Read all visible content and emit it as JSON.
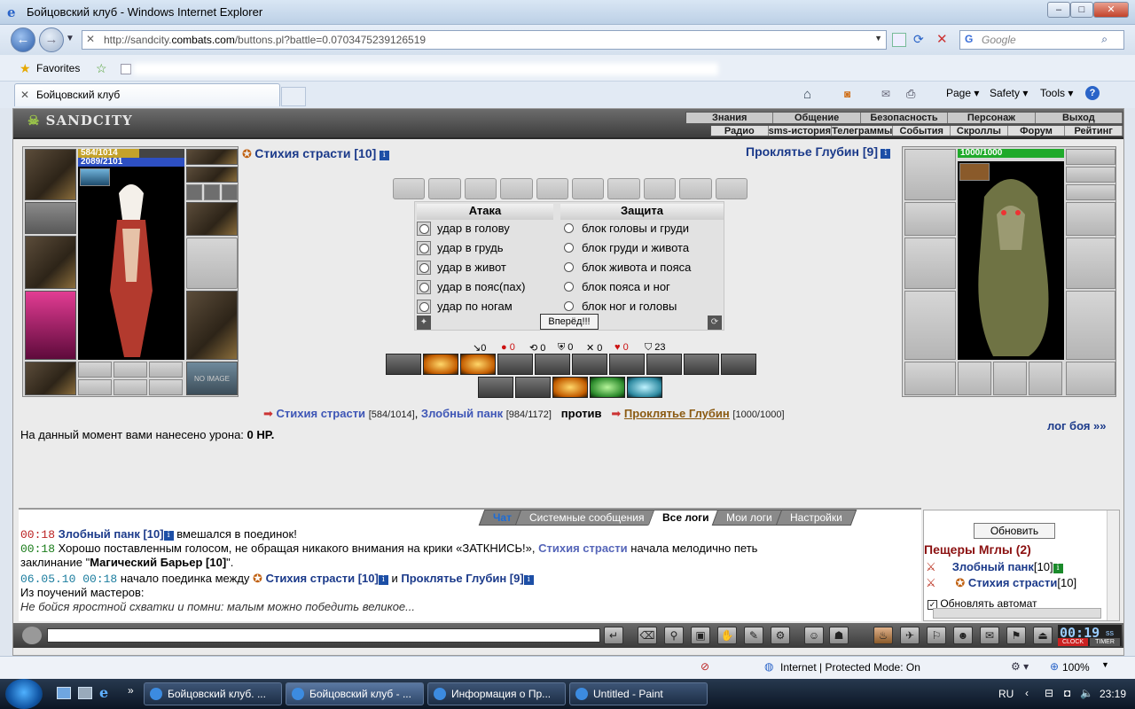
{
  "window": {
    "title": "Бойцовский клуб - Windows Internet Explorer"
  },
  "browser": {
    "url_prefix": "http://sandcity.",
    "url_domain": "combats.com",
    "url_suffix": "/buttons.pl?battle=0.0703475239126519",
    "search_placeholder": "Google",
    "favorites_label": "Favorites",
    "tab_title": "Бойцовский клуб",
    "cmd": {
      "page": "Page ▾",
      "safety": "Safety ▾",
      "tools": "Tools ▾"
    }
  },
  "game": {
    "logo": "SANDCITY",
    "menu_top": [
      "Знания",
      "Общение",
      "Безопасность",
      "Персонаж",
      "Выход"
    ],
    "menu_bottom": [
      "Радио",
      "sms-история",
      "Телеграммы",
      "События",
      "Скроллы",
      "Форум",
      "Рейтинг"
    ],
    "player": {
      "name": "Стихия страсти [10]",
      "hp": "584/1014",
      "mana": "2089/2101",
      "hp_fraction": 0.576,
      "slot_noimage": "NO IMAGE"
    },
    "enemy": {
      "name": "Проклятье Глубин [9]",
      "hp": "1000/1000",
      "hp_fraction": 1.0
    },
    "attack_header": "Атака",
    "defense_header": "Защита",
    "attack_options": [
      "удар в голову",
      "удар в грудь",
      "удар в живот",
      "удар в пояс(пах)",
      "удар по ногам"
    ],
    "defense_options": [
      "блок головы и груди",
      "блок груди и живота",
      "блок живота и пояса",
      "блок пояса и ног",
      "блок ног и головы"
    ],
    "go_button": "Вперёд!!!",
    "stats": [
      "↘0",
      "● 0",
      "⟲ 0",
      "⛨ 0",
      "✕ 0",
      "♥ 0",
      "⛉ 23"
    ],
    "vs": {
      "p1": "Стихия страсти",
      "p1_hp": "[584/1014]",
      "p2": "Злобный панк",
      "p2_hp": "[984/1172]",
      "word": "против",
      "enemy": "Проклятье Глубин",
      "enemy_hp": "[1000/1000]"
    },
    "damage_prefix": "На данный момент вами нанесено урона:",
    "damage_value": "0 HP.",
    "log_link": "лог боя »»"
  },
  "chat": {
    "tabs": [
      "Чат",
      "Системные сообщения",
      "Все логи",
      "Мои логи",
      "Настройки"
    ],
    "msg1": {
      "time": "00:18",
      "name": "Злобный панк [10]",
      "text": "вмешался в поединок!"
    },
    "msg2": {
      "time": "00:18",
      "text": "Хорошо поставленным голосом, не обращая никакого внимания на крики «ЗАТКНИСЬ!»,",
      "name": "Стихия страсти",
      "text2": "начала мелодично петь"
    },
    "msg2b": {
      "prefix": "заклинание \"",
      "spell": "Магический Барьер [10]",
      "suffix": "\"."
    },
    "msg3": {
      "time": "06.05.10 00:18",
      "text": "начало поединка между",
      "p1": "Стихия страсти [10]",
      "and": "и",
      "p2": "Проклятье Глубин [9]"
    },
    "msg4": "Из поучений мастеров:",
    "msg5": "Не бойся яростной схватки и помни: малым можно победить великое..."
  },
  "side": {
    "refresh": "Обновить",
    "room": "Пещеры Мглы (2)",
    "users": [
      {
        "name": "Злобный панк",
        "level": "[10]"
      },
      {
        "name": "Стихия страсти",
        "level": "[10]"
      }
    ],
    "auto": "Обновлять автомат"
  },
  "clock": {
    "time": "00:19",
    "sec": "ss",
    "label1": "CLOCK",
    "label2": "TIMER"
  },
  "status": {
    "zone": "Internet | Protected Mode: On",
    "zoom": "100%"
  },
  "taskbar": {
    "items": [
      "Бойцовский клуб. ...",
      "Бойцовский клуб - ...",
      "Информация о Пр...",
      "Untitled - Paint"
    ],
    "lang": "RU",
    "time": "23:19"
  }
}
